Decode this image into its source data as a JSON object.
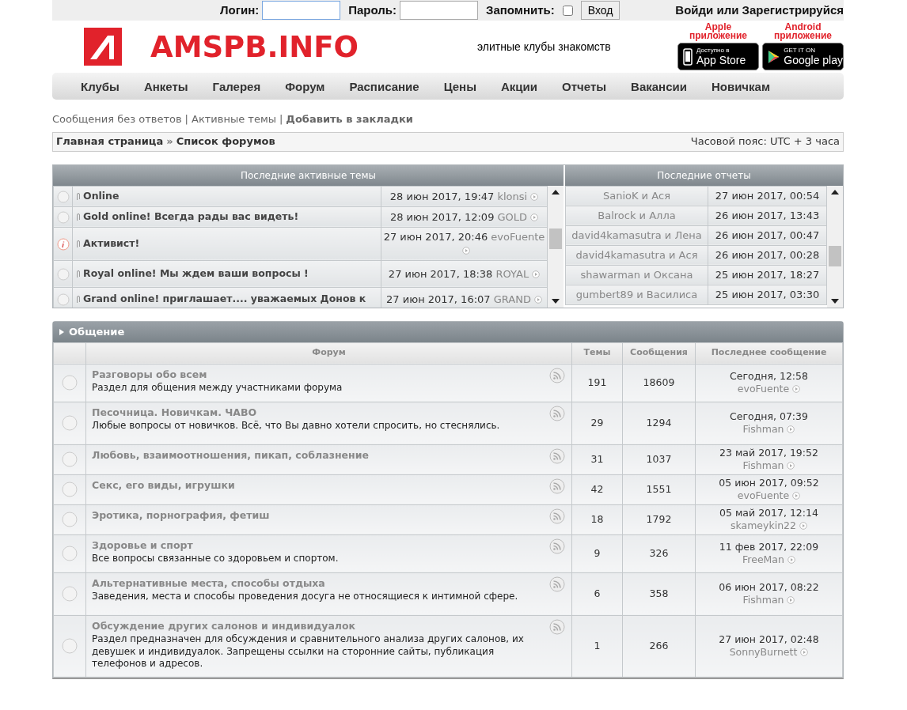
{
  "login_bar": {
    "login_label": "Логин:",
    "password_label": "Пароль:",
    "remember_label": "Запомнить:",
    "remember_checked": false,
    "submit": "Вход",
    "register_link": "Войди или Зарегистрируйся"
  },
  "header": {
    "site_name": "AMSPB.INFO",
    "tagline": "элитные клубы знакомств",
    "apps": [
      {
        "kind": "apple",
        "caption": [
          "Apple",
          "приложение"
        ],
        "small": "Доступно в",
        "big": "App Store"
      },
      {
        "kind": "android",
        "caption": [
          "Android",
          "приложение"
        ],
        "small": "GET IT ON",
        "big": "Google play"
      }
    ]
  },
  "nav": [
    "Клубы",
    "Анкеты",
    "Галерея",
    "Форум",
    "Расписание",
    "Цены",
    "Акции",
    "Отчеты",
    "Вакансии",
    "Новичкам"
  ],
  "quick_links": [
    {
      "label": "Сообщения без ответов",
      "bold": false
    },
    {
      "label": "Активные темы",
      "bold": false
    },
    {
      "label": "Добавить в закладки",
      "bold": true
    }
  ],
  "quick_links_separator": "|",
  "breadcrumb": {
    "items": [
      "Главная страница",
      "Список форумов"
    ],
    "separator": "»",
    "timezone": "Часовой пояс: UTC + 3 часа"
  },
  "active_topics": {
    "title": "Последние активные темы",
    "rows": [
      {
        "kind": "normal",
        "title": "Online",
        "date": "28 июн 2017, 19:47",
        "author": "klonsi"
      },
      {
        "kind": "normal",
        "title": "Gold online! Всегда рады вас видеть!",
        "date": "28 июн 2017, 12:09",
        "author": "GOLD"
      },
      {
        "kind": "info",
        "title": "Активист!",
        "date": "27 июн 2017, 20:46",
        "author": "evoFuente"
      },
      {
        "kind": "normal",
        "title": "Royal online! Мы ждем ваши вопросы !",
        "date": "27 июн 2017, 18:38",
        "author": "ROYAL"
      },
      {
        "kind": "normal",
        "title": "Grand online! приглашает.... уважаемых Донов к",
        "date": "27 июн 2017, 16:07",
        "author": "GRAND"
      }
    ]
  },
  "reports": {
    "title": "Последние отчеты",
    "rows": [
      {
        "pair": "SanioK и Ася",
        "date": "27 июн 2017, 00:54"
      },
      {
        "pair": "Balrock и Алла",
        "date": "26 июн 2017, 13:43"
      },
      {
        "pair": "david4kamasutra и Лена",
        "date": "26 июн 2017, 00:47"
      },
      {
        "pair": "david4kamasutra и Ася",
        "date": "26 июн 2017, 00:28"
      },
      {
        "pair": "shawarman и Оксана",
        "date": "25 июн 2017, 18:27"
      },
      {
        "pair": "gumbert89 и Василиса",
        "date": "25 июн 2017, 03:30"
      }
    ]
  },
  "category": {
    "title": "Общение",
    "columns": [
      "Форум",
      "Темы",
      "Сообщения",
      "Последнее сообщение"
    ],
    "forums": [
      {
        "title": "Разговоры обо всем",
        "description": "Раздел для общения между участниками форума",
        "topics": "191",
        "posts": "18609",
        "last_date": "Сегодня, 12:58",
        "last_author": "evoFuente"
      },
      {
        "title": "Песочница. Новичкам. ЧАВО",
        "description": "Любые вопросы от новичков. Всё, что Вы давно хотели спросить, но стеснялись.",
        "topics": "29",
        "posts": "1294",
        "last_date": "Сегодня, 07:39",
        "last_author": "Fishman"
      },
      {
        "title": "Любовь, взаимоотношения, пикап, соблазнение",
        "topics": "31",
        "posts": "1037",
        "last_date": "23 май 2017, 19:52",
        "last_author": "Fishman"
      },
      {
        "title": "Секс, его виды, игрушки",
        "topics": "42",
        "posts": "1551",
        "last_date": "05 июн 2017, 09:52",
        "last_author": "evoFuente"
      },
      {
        "title": "Эротика, порнография, фетиш",
        "topics": "18",
        "posts": "1792",
        "last_date": "05 май 2017, 12:14",
        "last_author": "skameykin22"
      },
      {
        "title": "Здоровье и спорт",
        "description": "Все вопросы связанные со здоровьем и спортом.",
        "topics": "9",
        "posts": "326",
        "last_date": "11 фев 2017, 22:09",
        "last_author": "FreeMan"
      },
      {
        "title": "Альтернативные места, способы отдыха",
        "description": "Заведения, места и способы проведения досуга не относящиеся к интимной сфере.",
        "topics": "6",
        "posts": "358",
        "last_date": "06 июн 2017, 08:22",
        "last_author": "Fishman"
      },
      {
        "title": "Обсуждение других салонов и индивидуалок",
        "description": "Раздел предназначен для обсуждения и сравнительного анализа других салонов, их девушек и индивидуалок. Запрещены ссылки на сторонние сайты, публикация телефонов и адресов.",
        "topics": "1",
        "posts": "266",
        "last_date": "27 июн 2017, 02:48",
        "last_author": "SonnyBurnett"
      }
    ]
  }
}
